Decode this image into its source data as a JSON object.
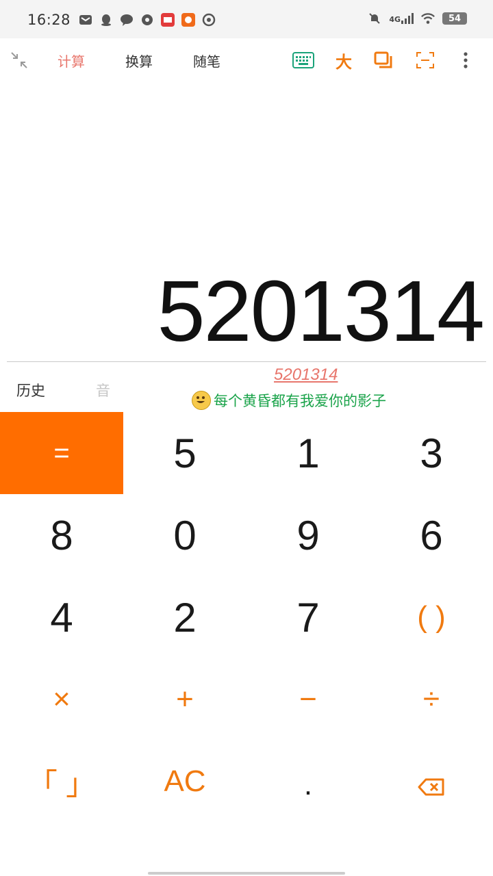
{
  "status_bar": {
    "time": "16:28",
    "network": "4G",
    "battery": "54"
  },
  "toolbar": {
    "tabs": [
      {
        "label": "计算",
        "active": true
      },
      {
        "label": "换算",
        "active": false
      },
      {
        "label": "随笔",
        "active": false
      }
    ],
    "size_label": "大"
  },
  "display": {
    "value": "5201314"
  },
  "under_display": {
    "history_label": "历史",
    "sound_label": "音",
    "easter_number": "5201314",
    "easter_message": "每个黄昏都有我爱你的影子"
  },
  "keypad": {
    "keys": [
      [
        "=",
        "5",
        "1",
        "3"
      ],
      [
        "8",
        "0",
        "9",
        "6"
      ],
      [
        "4",
        "2",
        "7",
        "( )"
      ],
      [
        "×",
        "+",
        "−",
        "÷"
      ],
      [
        "「 」",
        "AC",
        ".",
        "⌫"
      ]
    ]
  },
  "colors": {
    "accent_orange": "#ff6d00",
    "operator_orange": "#f07a10",
    "active_tab": "#e8766c",
    "message_green": "#1aa34a"
  }
}
